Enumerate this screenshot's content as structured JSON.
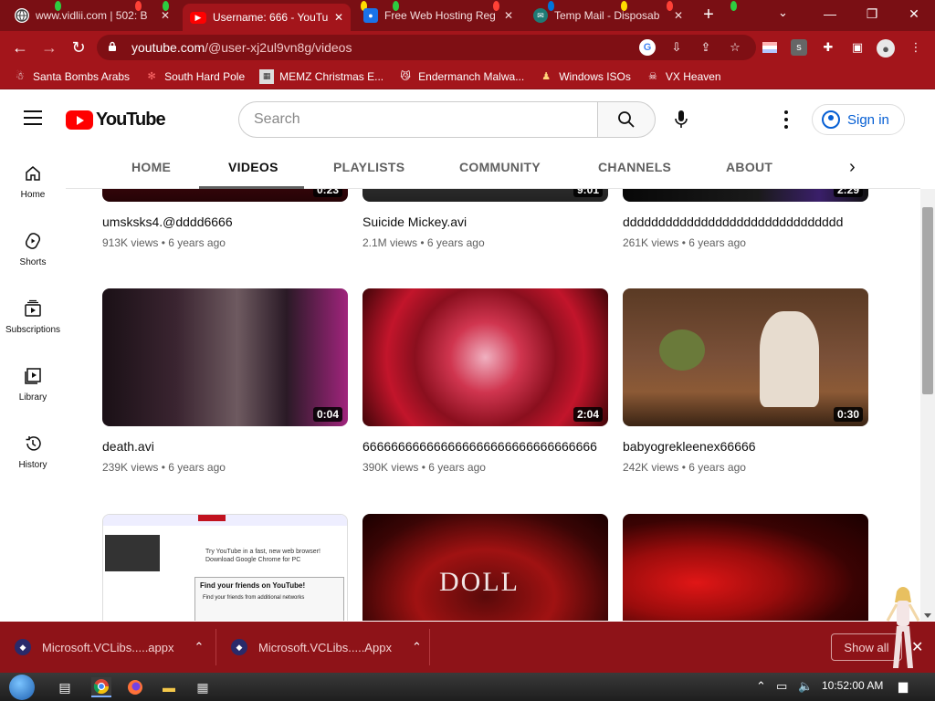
{
  "browser": {
    "tabs": [
      {
        "title": "www.vidlii.com | 502: B",
        "icon": "globe-icon",
        "active": false
      },
      {
        "title": "Username: 666 - YouTube",
        "icon": "youtube-icon",
        "active": true
      },
      {
        "title": "Free Web Hosting Reg",
        "icon": "hosting-icon",
        "active": false
      },
      {
        "title": "Temp Mail - Disposab",
        "icon": "tempmail-icon",
        "active": false
      }
    ],
    "url_host": "youtube.com",
    "url_path": "/@user-xj2ul9vn8g/videos",
    "bookmarks": [
      {
        "label": "Santa Bombs Arabs",
        "icon": "person-icon"
      },
      {
        "label": "South Hard Pole",
        "icon": "snowflake-icon"
      },
      {
        "label": "MEMZ Christmas E...",
        "icon": "image-icon"
      },
      {
        "label": "Endermanch Malwa...",
        "icon": "cat-icon"
      },
      {
        "label": "Windows ISOs",
        "icon": "person-icon"
      },
      {
        "label": "VX Heaven",
        "icon": "skull-icon"
      }
    ]
  },
  "youtube": {
    "logo_text": "YouTube",
    "search_placeholder": "Search",
    "signin_label": "Sign in",
    "sidebar": [
      {
        "label": "Home",
        "icon": "home-icon"
      },
      {
        "label": "Shorts",
        "icon": "shorts-icon"
      },
      {
        "label": "Subscriptions",
        "icon": "subscriptions-icon"
      },
      {
        "label": "Library",
        "icon": "library-icon"
      },
      {
        "label": "History",
        "icon": "history-icon"
      }
    ],
    "channel_tabs": [
      "HOME",
      "VIDEOS",
      "PLAYLISTS",
      "COMMUNITY",
      "CHANNELS",
      "ABOUT"
    ],
    "active_tab": "VIDEOS",
    "videos": [
      {
        "title": "umsksks4.@dddd6666",
        "views": "913K views",
        "age": "6 years ago",
        "duration": "0:23"
      },
      {
        "title": "Suicide Mickey.avi",
        "views": "2.1M views",
        "age": "6 years ago",
        "duration": "9:01"
      },
      {
        "title": "ddddddddddddddddddddddddddddddd",
        "views": "261K views",
        "age": "6 years ago",
        "duration": "2:29"
      },
      {
        "title": "death.avi",
        "views": "239K views",
        "age": "6 years ago",
        "duration": "0:04"
      },
      {
        "title": "666666666666666666666666666666666",
        "views": "390K views",
        "age": "6 years ago",
        "duration": "2:04"
      },
      {
        "title": "babyogrekleenex66666",
        "views": "242K views",
        "age": "6 years ago",
        "duration": "0:30"
      },
      {
        "title": "",
        "views": "",
        "age": "",
        "duration": ""
      },
      {
        "title": "",
        "views": "",
        "age": "",
        "duration": ""
      },
      {
        "title": "",
        "views": "",
        "age": "",
        "duration": ""
      }
    ],
    "thumb_texts": {
      "youtube_page_banner": "Try YouTube in a fast, new web browser! Download Google Chrome for PC",
      "find_friends": "Find your friends on YouTube!",
      "find_friends_sub": "Find your friends from additional networks",
      "doll_text": "DOLL"
    }
  },
  "downloads": {
    "items": [
      "Microsoft.VCLibs.....appx",
      "Microsoft.VCLibs.....Appx"
    ],
    "show_all": "Show all"
  },
  "taskbar": {
    "clock": "10:52:00 AM"
  },
  "colors": {
    "chrome_dark": "#7a0f14",
    "chrome_toolbar": "#a3151b",
    "youtube_red": "#ff0000",
    "signin_blue": "#065fd4"
  }
}
